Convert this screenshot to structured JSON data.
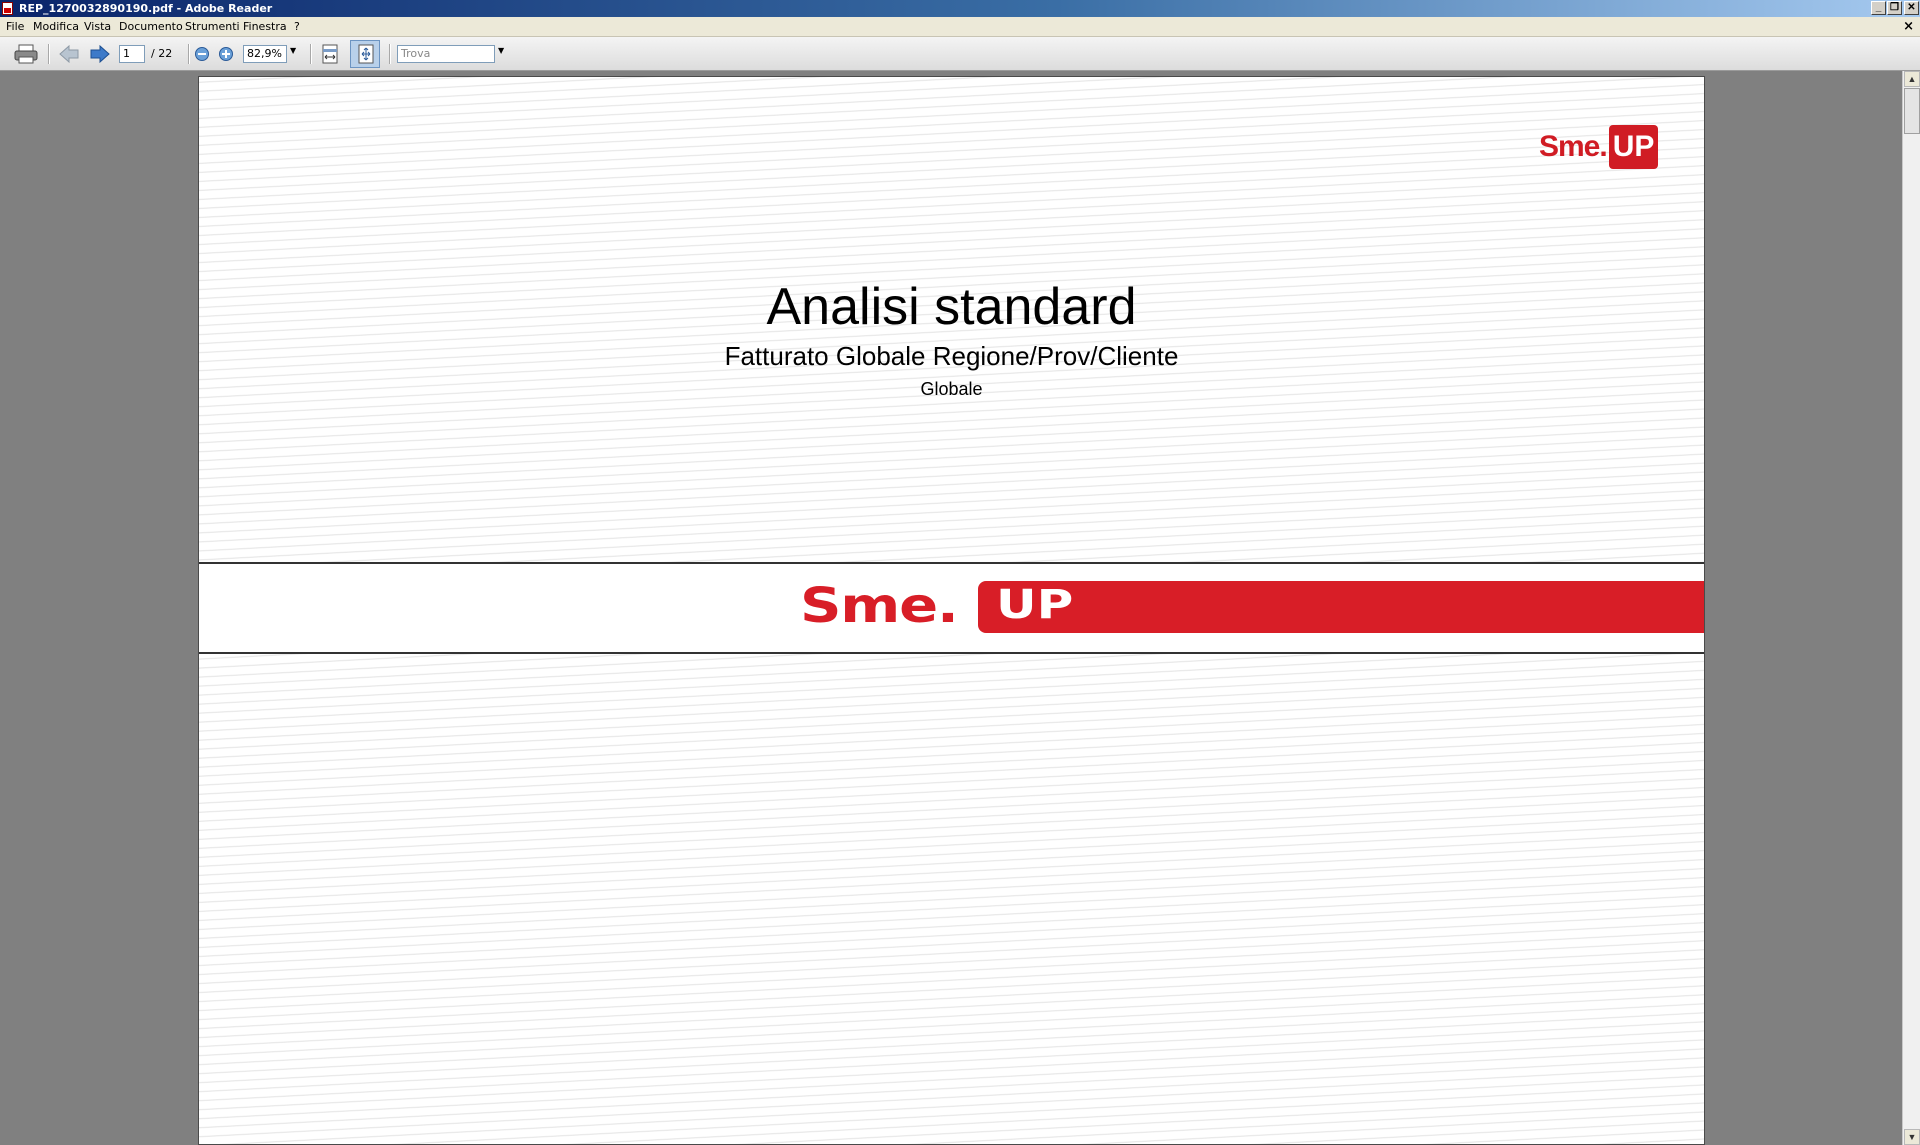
{
  "window": {
    "title": "REP_1270032890190.pdf - Adobe Reader",
    "minimize": "_",
    "restore": "❐",
    "close": "✕"
  },
  "menu": {
    "items": [
      "File",
      "Modifica",
      "Vista",
      "Documento",
      "Strumenti",
      "Finestra",
      "?"
    ],
    "doc_close": "×"
  },
  "toolbar": {
    "current_page": "1",
    "page_total": "/ 22",
    "zoom": "82,9%",
    "find_placeholder": "Trova"
  },
  "page": {
    "logo_small_sme": "Sme.",
    "logo_small_up": "UP",
    "title": "Analisi standard",
    "subtitle": "Fatturato Globale Regione/Prov/Cliente",
    "subtitle2": "Globale",
    "band_sme": "Sme.",
    "band_up": "UP"
  },
  "colors": {
    "brand_red": "#d81e27",
    "titlebar": "#0a246a"
  }
}
